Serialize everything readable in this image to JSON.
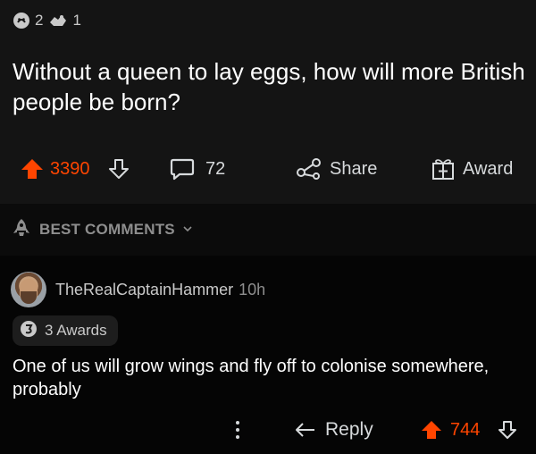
{
  "colors": {
    "accent": "#ff4500",
    "background": "#000000",
    "post_background": "#141414",
    "text": "#ffffff",
    "muted": "#8e8e8e"
  },
  "post": {
    "awards": [
      {
        "icon": "silver-award-icon",
        "count": "2"
      },
      {
        "icon": "helpful-award-icon",
        "count": "1"
      }
    ],
    "title": "Without a queen to lay eggs, how will more British people be born?",
    "actions": {
      "upvote_icon": "arrow-up-icon",
      "score": "3390",
      "downvote_icon": "arrow-down-icon",
      "comments_count": "72",
      "share_label": "Share",
      "award_label": "Award"
    }
  },
  "sort": {
    "icon": "rocket-icon",
    "label": "BEST COMMENTS"
  },
  "comment": {
    "username": "TheRealCaptainHammer",
    "time": "10h",
    "awards_label": "3 Awards",
    "body": "One of us will grow wings and fly off to colonise somewhere, probably",
    "actions": {
      "reply_label": "Reply",
      "score": "744"
    }
  }
}
